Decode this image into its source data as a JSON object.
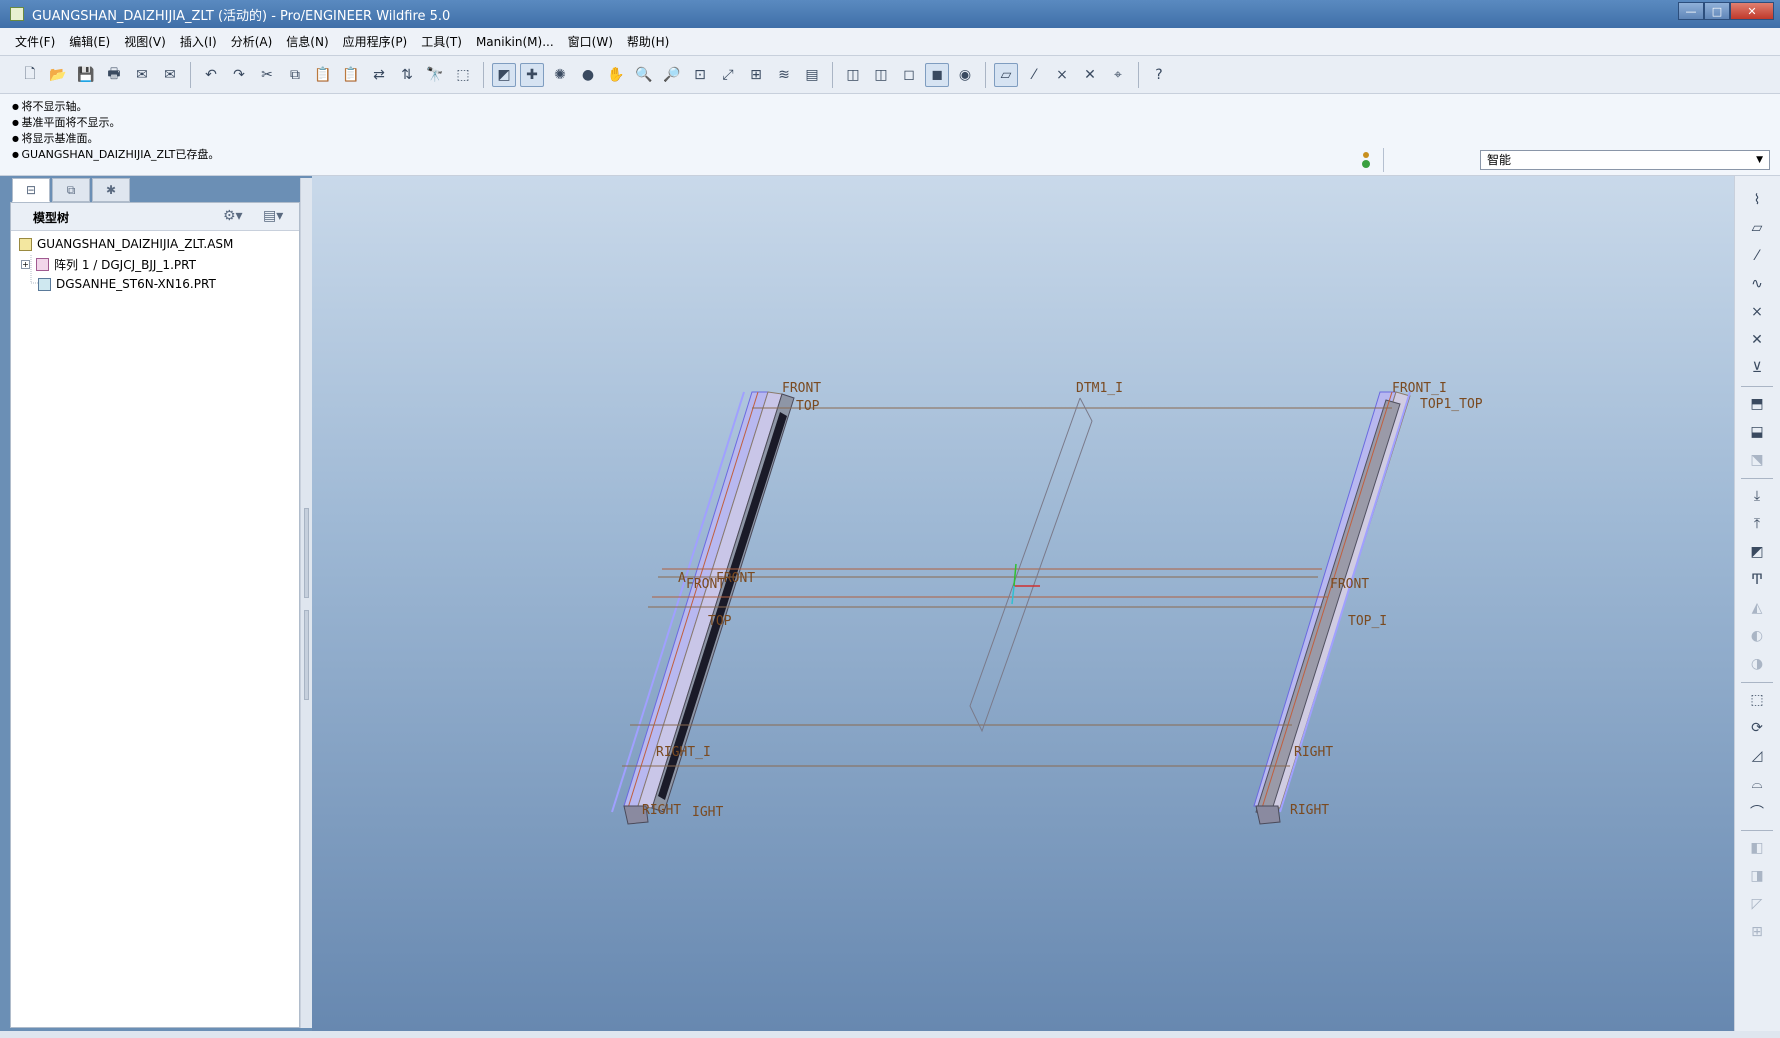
{
  "window": {
    "title": "GUANGSHAN_DAIZHIJIA_ZLT (活动的) - Pro/ENGINEER Wildfire 5.0",
    "controls": {
      "minimize": "—",
      "maximize": "□",
      "close": "✕"
    }
  },
  "menu": [
    "文件(F)",
    "编辑(E)",
    "视图(V)",
    "插入(I)",
    "分析(A)",
    "信息(N)",
    "应用程序(P)",
    "工具(T)",
    "Manikin(M)...",
    "窗口(W)",
    "帮助(H)"
  ],
  "toolbar": {
    "groups": [
      [
        {
          "name": "new-file-icon",
          "glyph": "🗋"
        },
        {
          "name": "open-file-icon",
          "glyph": "📂"
        },
        {
          "name": "save-icon",
          "glyph": "💾"
        },
        {
          "name": "print-icon",
          "glyph": "🖶"
        },
        {
          "name": "email-icon",
          "glyph": "✉"
        },
        {
          "name": "email-link-icon",
          "glyph": "✉"
        }
      ],
      [
        {
          "name": "undo-icon",
          "glyph": "↶"
        },
        {
          "name": "redo-icon",
          "glyph": "↷"
        },
        {
          "name": "cut-icon",
          "glyph": "✂"
        },
        {
          "name": "copy-icon",
          "glyph": "⧉"
        },
        {
          "name": "paste-icon",
          "glyph": "📋"
        },
        {
          "name": "paste-special-icon",
          "glyph": "📋"
        },
        {
          "name": "regenerate-icon",
          "glyph": "⇄"
        },
        {
          "name": "regen-manager-icon",
          "glyph": "⇅"
        },
        {
          "name": "find-icon",
          "glyph": "🔭"
        },
        {
          "name": "select-box-icon",
          "glyph": "⬚"
        }
      ],
      [
        {
          "name": "repaint-icon",
          "glyph": "◩",
          "active": true
        },
        {
          "name": "spin-center-icon",
          "glyph": "✚",
          "active": true
        },
        {
          "name": "orient-mode-icon",
          "glyph": "✺"
        },
        {
          "name": "display-style-icon",
          "glyph": "●"
        },
        {
          "name": "pan-icon",
          "glyph": "✋"
        },
        {
          "name": "zoom-in-icon",
          "glyph": "🔍"
        },
        {
          "name": "zoom-out-icon",
          "glyph": "🔎"
        },
        {
          "name": "refit-icon",
          "glyph": "⊡"
        },
        {
          "name": "reorient-icon",
          "glyph": "⤢"
        },
        {
          "name": "saved-views-icon",
          "glyph": "⊞"
        },
        {
          "name": "layers-icon",
          "glyph": "≋"
        },
        {
          "name": "view-manager-icon",
          "glyph": "▤"
        }
      ],
      [
        {
          "name": "wireframe-icon",
          "glyph": "◫"
        },
        {
          "name": "hidden-line-icon",
          "glyph": "◫"
        },
        {
          "name": "no-hidden-icon",
          "glyph": "◻"
        },
        {
          "name": "shading-icon",
          "glyph": "◼",
          "active": true
        },
        {
          "name": "enhanced-realism-icon",
          "glyph": "◉"
        }
      ],
      [
        {
          "name": "datum-planes-icon",
          "glyph": "▱",
          "active": true
        },
        {
          "name": "datum-axes-icon",
          "glyph": "⁄"
        },
        {
          "name": "datum-points-icon",
          "glyph": "×"
        },
        {
          "name": "coordinate-systems-icon",
          "glyph": "✕"
        },
        {
          "name": "annotations-icon",
          "glyph": "⌖"
        }
      ],
      [
        {
          "name": "context-help-icon",
          "glyph": "?"
        }
      ]
    ]
  },
  "messages": [
    "将不显示轴。",
    "基准平面将不显示。",
    "将显示基准面。",
    "GUANGSHAN_DAIZHIJIA_ZLT已存盘。"
  ],
  "filter": {
    "value": "智能"
  },
  "navigator": {
    "tabs": [
      {
        "name": "model-tree-tab-icon",
        "glyph": "⊟"
      },
      {
        "name": "folder-browser-tab-icon",
        "glyph": "⧉"
      },
      {
        "name": "favorites-tab-icon",
        "glyph": "✱"
      }
    ],
    "title": "模型树",
    "tree": [
      {
        "label": "GUANGSHAN_DAIZHIJIA_ZLT.ASM",
        "type": "asm",
        "indent": 0
      },
      {
        "label": "阵列 1 / DGJCJ_BJJ_1.PRT",
        "type": "pattern",
        "indent": 1,
        "expander": "+"
      },
      {
        "label": "DGSANHE_ST6N-XN16.PRT",
        "type": "part",
        "indent": 1
      }
    ]
  },
  "graphics": {
    "datum_labels": {
      "front_tl": "FRONT",
      "top_tl": "TOP",
      "dtm1": "DTM1_I",
      "front1_tr": "FRONT_I",
      "top1_tr": "TOP1_TOP",
      "asm_front_l": "A",
      "front_ml": "FRONT",
      "front_ml2": "FRONT",
      "front_mr": "FRONT",
      "top_ml": "TOP",
      "top1_mr": "TOP_I",
      "right1_l": "RIGHT_I",
      "right_r": "RIGHT",
      "right_bl": "RIGHT",
      "right_bl2": "IGHT",
      "right_br": "RIGHT"
    }
  },
  "right_toolbar": [
    {
      "name": "sketch-datum-curve-icon",
      "glyph": "⌇"
    },
    {
      "name": "datum-plane-tool-icon",
      "glyph": "▱"
    },
    {
      "name": "datum-axis-tool-icon",
      "glyph": "⁄"
    },
    {
      "name": "datum-curve-tool-icon",
      "glyph": "∿"
    },
    {
      "name": "datum-point-tool-icon",
      "glyph": "×"
    },
    {
      "name": "coordinate-system-tool-icon",
      "glyph": "✕"
    },
    {
      "name": "analysis-feature-icon",
      "glyph": "⊻"
    },
    {
      "sep": true
    },
    {
      "name": "assemble-component-icon",
      "glyph": "⬒"
    },
    {
      "name": "create-component-icon",
      "glyph": "⬓"
    },
    {
      "name": "package-component-icon",
      "glyph": "⬔",
      "dim": true
    },
    {
      "sep": true
    },
    {
      "name": "insert-component-icon",
      "glyph": "⤓"
    },
    {
      "name": "new-component-icon",
      "glyph": "⤒"
    },
    {
      "name": "edit-component-icon",
      "glyph": "◩"
    },
    {
      "name": "hole-tool-icon",
      "glyph": "Ͳ"
    },
    {
      "name": "extrude-disabled-icon",
      "glyph": "◭",
      "dim": true
    },
    {
      "name": "revolve-disabled-icon",
      "glyph": "◐",
      "dim": true
    },
    {
      "name": "sweep-disabled-icon",
      "glyph": "◑",
      "dim": true
    },
    {
      "sep": true
    },
    {
      "name": "extrude-tool-icon",
      "glyph": "⬚"
    },
    {
      "name": "revolve-tool-icon",
      "glyph": "⟳"
    },
    {
      "name": "blend-tool-icon",
      "glyph": "◿"
    },
    {
      "name": "boundary-blend-icon",
      "glyph": "⌓"
    },
    {
      "name": "style-tool-icon",
      "glyph": "⌒"
    },
    {
      "sep": true
    },
    {
      "name": "mirror-disabled-icon",
      "glyph": "◧",
      "dim": true
    },
    {
      "name": "merge-disabled-icon",
      "glyph": "◨",
      "dim": true
    },
    {
      "name": "trim-disabled-icon",
      "glyph": "◸",
      "dim": true
    },
    {
      "name": "pattern-tool-icon",
      "glyph": "⊞",
      "dim": true
    }
  ]
}
